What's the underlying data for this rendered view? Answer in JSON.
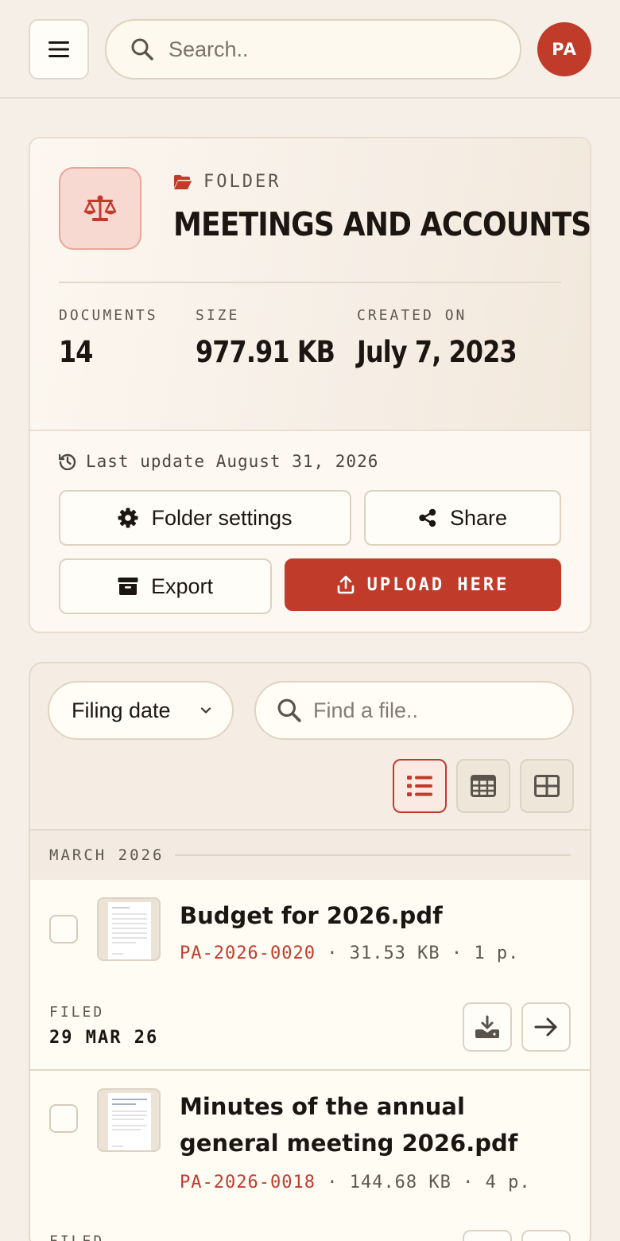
{
  "header": {
    "search_placeholder": "Search..",
    "avatar_initials": "PA"
  },
  "folder": {
    "kicker": "FOLDER",
    "title": "MEETINGS AND ACCOUNTS",
    "stats": {
      "documents_label": "DOCUMENTS",
      "documents_value": "14",
      "size_label": "SIZE",
      "size_value": "977.91 KB",
      "created_label": "CREATED ON",
      "created_value": "July 7, 2023"
    },
    "last_update": "Last update August 31, 2026",
    "buttons": {
      "settings": "Folder settings",
      "share": "Share",
      "export": "Export",
      "upload": "UPLOAD HERE"
    },
    "accent_color": "#c13b2b"
  },
  "files": {
    "sort_value": "Filing date",
    "find_placeholder": "Find a file..",
    "view_mode": "list",
    "groups": [
      {
        "month": "MARCH 2026",
        "items": [
          {
            "name": "Budget for 2026.pdf",
            "ref": "PA-2026-0020",
            "size": "31.53 KB",
            "pages": "1 p.",
            "filed_label": "FILED",
            "filed_date": "29 MAR 26"
          },
          {
            "name": "Minutes of the annual general meeting 2026.pdf",
            "ref": "PA-2026-0018",
            "size": "144.68 KB",
            "pages": "4 p.",
            "filed_label": "FILED",
            "filed_date": ""
          }
        ]
      }
    ]
  }
}
